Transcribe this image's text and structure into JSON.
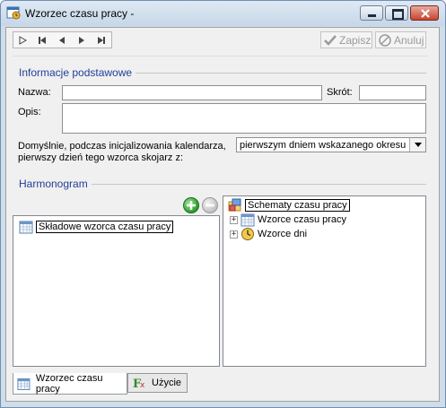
{
  "window": {
    "title": "Wzorzec czasu pracy -"
  },
  "toolbar": {
    "nav": [
      "first",
      "prev-skip",
      "prev",
      "next",
      "last"
    ],
    "save_label": "Zapisz",
    "cancel_label": "Anuluj"
  },
  "basic": {
    "section_title": "Informacje podstawowe",
    "name_label": "Nazwa:",
    "name_value": "",
    "short_label": "Skrót:",
    "short_value": "",
    "description_label": "Opis:",
    "description_value": "",
    "default_label_line1": "Domyślnie, podczas inicjalizowania kalendarza,",
    "default_label_line2": "pierwszy dzień tego wzorca skojarz z:",
    "default_value": "pierwszym dniem wskazanego okresu"
  },
  "schedule": {
    "section_title": "Harmonogram",
    "left_tree": {
      "root": "Składowe wzorca czasu pracy"
    },
    "right_tree": {
      "root": "Schematy czasu pracy",
      "children": [
        "Wzorce czasu pracy",
        "Wzorce dni"
      ]
    }
  },
  "tabs": [
    "Wzorzec czasu pracy",
    "Użycie"
  ],
  "colors": {
    "section_title": "#1f3f99",
    "add_button": "#3aa63a"
  }
}
